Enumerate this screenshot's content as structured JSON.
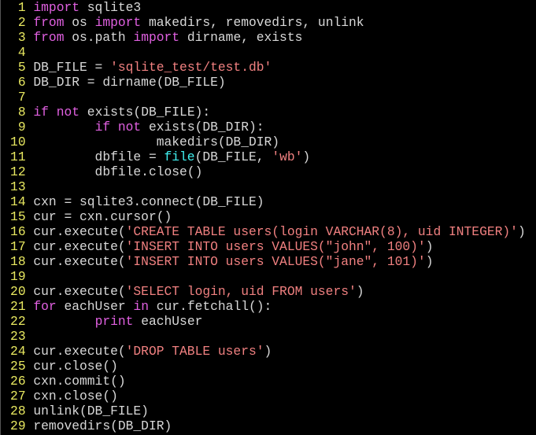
{
  "colors": {
    "background": "#000000",
    "line_number": "#e8e860",
    "keyword": "#e060e0",
    "string": "#f08080",
    "builtin": "#40f0f0",
    "text": "#d8d8d8"
  },
  "lines": [
    [
      [
        "kw",
        "import"
      ],
      [
        "tx",
        " sqlite3"
      ]
    ],
    [
      [
        "kw",
        "from"
      ],
      [
        "tx",
        " os "
      ],
      [
        "kw",
        "import"
      ],
      [
        "tx",
        " makedirs, removedirs, unlink"
      ]
    ],
    [
      [
        "kw",
        "from"
      ],
      [
        "tx",
        " os.path "
      ],
      [
        "kw",
        "import"
      ],
      [
        "tx",
        " dirname, exists"
      ]
    ],
    [],
    [
      [
        "tx",
        "DB_FILE = "
      ],
      [
        "str",
        "'sqlite_test/test.db'"
      ]
    ],
    [
      [
        "tx",
        "DB_DIR = dirname(DB_FILE)"
      ]
    ],
    [],
    [
      [
        "kw",
        "if"
      ],
      [
        "tx",
        " "
      ],
      [
        "kw",
        "not"
      ],
      [
        "tx",
        " exists(DB_FILE):"
      ]
    ],
    [
      [
        "tx",
        "        "
      ],
      [
        "kw",
        "if"
      ],
      [
        "tx",
        " "
      ],
      [
        "kw",
        "not"
      ],
      [
        "tx",
        " exists(DB_DIR):"
      ]
    ],
    [
      [
        "tx",
        "                makedirs(DB_DIR)"
      ]
    ],
    [
      [
        "tx",
        "        dbfile = "
      ],
      [
        "bi",
        "file"
      ],
      [
        "tx",
        "(DB_FILE, "
      ],
      [
        "str",
        "'wb'"
      ],
      [
        "tx",
        ")"
      ]
    ],
    [
      [
        "tx",
        "        dbfile.close()"
      ]
    ],
    [],
    [
      [
        "tx",
        "cxn = sqlite3.connect(DB_FILE)"
      ]
    ],
    [
      [
        "tx",
        "cur = cxn.cursor()"
      ]
    ],
    [
      [
        "tx",
        "cur.execute("
      ],
      [
        "str",
        "'CREATE TABLE users(login VARCHAR(8), uid INTEGER)'"
      ],
      [
        "tx",
        ")"
      ]
    ],
    [
      [
        "tx",
        "cur.execute("
      ],
      [
        "str",
        "'INSERT INTO users VALUES(\"john\", 100)'"
      ],
      [
        "tx",
        ")"
      ]
    ],
    [
      [
        "tx",
        "cur.execute("
      ],
      [
        "str",
        "'INSERT INTO users VALUES(\"jane\", 101)'"
      ],
      [
        "tx",
        ")"
      ]
    ],
    [],
    [
      [
        "tx",
        "cur.execute("
      ],
      [
        "str",
        "'SELECT login, uid FROM users'"
      ],
      [
        "tx",
        ")"
      ]
    ],
    [
      [
        "kw",
        "for"
      ],
      [
        "tx",
        " eachUser "
      ],
      [
        "kw",
        "in"
      ],
      [
        "tx",
        " cur.fetchall():"
      ]
    ],
    [
      [
        "tx",
        "        "
      ],
      [
        "kw",
        "print"
      ],
      [
        "tx",
        " eachUser"
      ]
    ],
    [],
    [
      [
        "tx",
        "cur.execute("
      ],
      [
        "str",
        "'DROP TABLE users'"
      ],
      [
        "tx",
        ")"
      ]
    ],
    [
      [
        "tx",
        "cur.close()"
      ]
    ],
    [
      [
        "tx",
        "cxn.commit()"
      ]
    ],
    [
      [
        "tx",
        "cxn.close()"
      ]
    ],
    [
      [
        "tx",
        "unlink(DB_FILE)"
      ]
    ],
    [
      [
        "tx",
        "removedirs(DB_DIR)"
      ]
    ]
  ],
  "line_numbers": [
    "1",
    "2",
    "3",
    "4",
    "5",
    "6",
    "7",
    "8",
    "9",
    "10",
    "11",
    "12",
    "13",
    "14",
    "15",
    "16",
    "17",
    "18",
    "19",
    "20",
    "21",
    "22",
    "23",
    "24",
    "25",
    "26",
    "27",
    "28",
    "29"
  ]
}
